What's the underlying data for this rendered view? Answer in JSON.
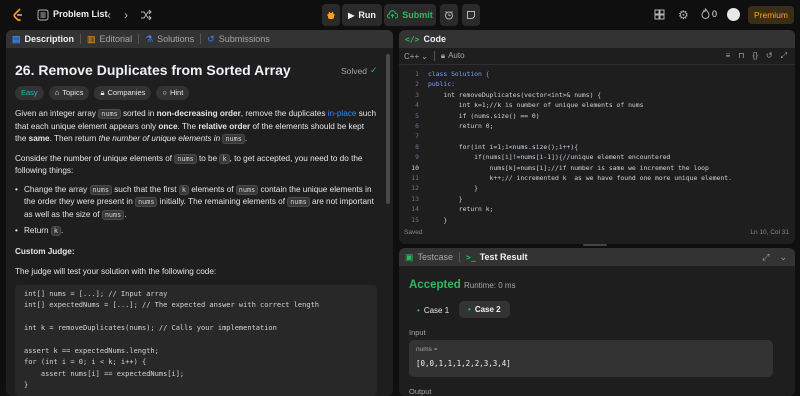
{
  "topbar": {
    "title": "Problem List",
    "run_label": "Run",
    "submit_label": "Submit",
    "streak_count": "0",
    "premium_label": "Premium"
  },
  "left": {
    "tabs": [
      "Description",
      "Editorial",
      "Solutions",
      "Submissions"
    ],
    "title": "26. Remove Duplicates from Sorted Array",
    "solved_label": "Solved",
    "tags": [
      "Easy",
      "Topics",
      "Companies",
      "Hint"
    ],
    "p1": {
      "a": "Given an integer array ",
      "c1": "nums",
      "b": " sorted in ",
      "bold1": "non-decreasing order",
      "c": ", remove the duplicates ",
      "link": "in-place",
      "d": " such that each unique element appears only ",
      "bold2": "once",
      "e": ". The ",
      "bold3": "relative order",
      "f": " of the elements should be kept the ",
      "bold4": "same",
      "g": ". Then return ",
      "ital": "the number of unique elements in",
      "h": " ",
      "c2": "nums",
      "i": "."
    },
    "p2": {
      "a": "Consider the number of unique elements of ",
      "c1": "nums",
      "b": " to be ",
      "c2": "k",
      "c": ", to get accepted, you need to do the following things:"
    },
    "li1": {
      "a": "Change the array ",
      "c1": "nums",
      "b": " such that the first ",
      "c2": "k",
      "c": " elements of ",
      "c3": "nums",
      "d": " contain the unique elements in the order they were present in ",
      "c4": "nums",
      "e": " initially. The remaining elements of ",
      "c5": "nums",
      "f": " are not important as well as the size of ",
      "c6": "nums",
      "g": "."
    },
    "li2": {
      "a": "Return ",
      "c1": "k",
      "b": "."
    },
    "judge_heading": "Custom Judge:",
    "judge_text": "The judge will test your solution with the following code:",
    "judge_code": [
      "int[] nums = [...]; // Input array",
      "int[] expectedNums = [...]; // The expected answer with correct length",
      "",
      "int k = removeDuplicates(nums); // Calls your implementation",
      "",
      "assert k == expectedNums.length;",
      "for (int i = 0; i < k; i++) {",
      "    assert nums[i] == expectedNums[i];",
      "}"
    ]
  },
  "code": {
    "tab_label": "Code",
    "language": "C++",
    "mode": "Auto",
    "lines": [
      "class Solution {",
      "public:",
      "    int removeDuplicates(vector<int>& nums) {",
      "        int k=1;//k is number of unique elements of nums",
      "        if (nums.size() == 0)",
      "        return 0;",
      "",
      "        for(int i=1;i<nums.size();i++){",
      "            if(nums[i]!=nums[i-1]){//unique element encountered",
      "                nums[k]=nums[i];//if number is same we increment the loop",
      "                k++;// incremented k  as we have found one more unique element.",
      "            }",
      "        }",
      "        return k;",
      "    }"
    ],
    "line_numbers": [
      "1",
      "2",
      "3",
      "4",
      "5",
      "6",
      "7",
      "8",
      "9",
      "10",
      "11",
      "12",
      "13",
      "14",
      "15"
    ],
    "status_left": "Saved",
    "status_right": "Ln 10, Col 31"
  },
  "result": {
    "tabs": [
      "Testcase",
      "Test Result"
    ],
    "status": "Accepted",
    "runtime": "Runtime: 0 ms",
    "cases": [
      "Case 1",
      "Case 2"
    ],
    "input_label": "Input",
    "var_name": "nums =",
    "var_value": "[0,0,1,1,1,2,2,3,3,4]",
    "output_label": "Output"
  },
  "colors": {
    "accent_green": "#2cbb5d",
    "accent_orange": "#ffa116",
    "link_blue": "#3b82f6"
  }
}
